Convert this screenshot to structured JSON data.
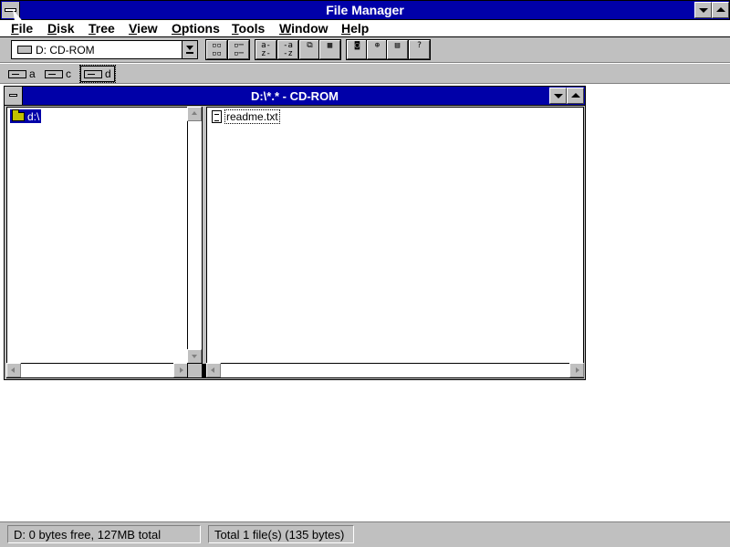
{
  "app": {
    "title": "File Manager"
  },
  "menu": {
    "items": [
      "File",
      "Disk",
      "Tree",
      "View",
      "Options",
      "Tools",
      "Window",
      "Help"
    ]
  },
  "toolbar": {
    "drive_combo_value": "D: CD-ROM",
    "buttons": [
      {
        "icon": "connect-network-icon"
      },
      {
        "icon": "disconnect-network-icon"
      },
      {
        "icon": "sort-by-name-icon"
      },
      {
        "icon": "sort-by-type-icon"
      },
      {
        "icon": "copy-disk-icon"
      },
      {
        "icon": "view-details-icon"
      },
      {
        "icon": "disk-icon"
      },
      {
        "icon": "share-icon"
      },
      {
        "icon": "stop-sharing-icon"
      },
      {
        "icon": "context-help-icon"
      }
    ]
  },
  "drives": [
    {
      "letter": "a",
      "icon": "floppy-drive-icon",
      "selected": false
    },
    {
      "letter": "c",
      "icon": "hard-drive-icon",
      "selected": false
    },
    {
      "letter": "d",
      "icon": "cdrom-drive-icon",
      "selected": true
    }
  ],
  "child_window": {
    "title": "D:\\*.* - CD-ROM",
    "tree": {
      "items": [
        {
          "label": "d:\\",
          "icon": "open-folder-icon",
          "selected": true
        }
      ]
    },
    "files": {
      "items": [
        {
          "label": "readme.txt",
          "icon": "text-file-icon"
        }
      ]
    }
  },
  "status": {
    "left": "D: 0 bytes free,  127MB total",
    "right": "Total 1 file(s) (135 bytes)"
  },
  "colors": {
    "title_bar": "#0000a8",
    "face": "#c0c0c0",
    "selection": "#0000a8"
  }
}
